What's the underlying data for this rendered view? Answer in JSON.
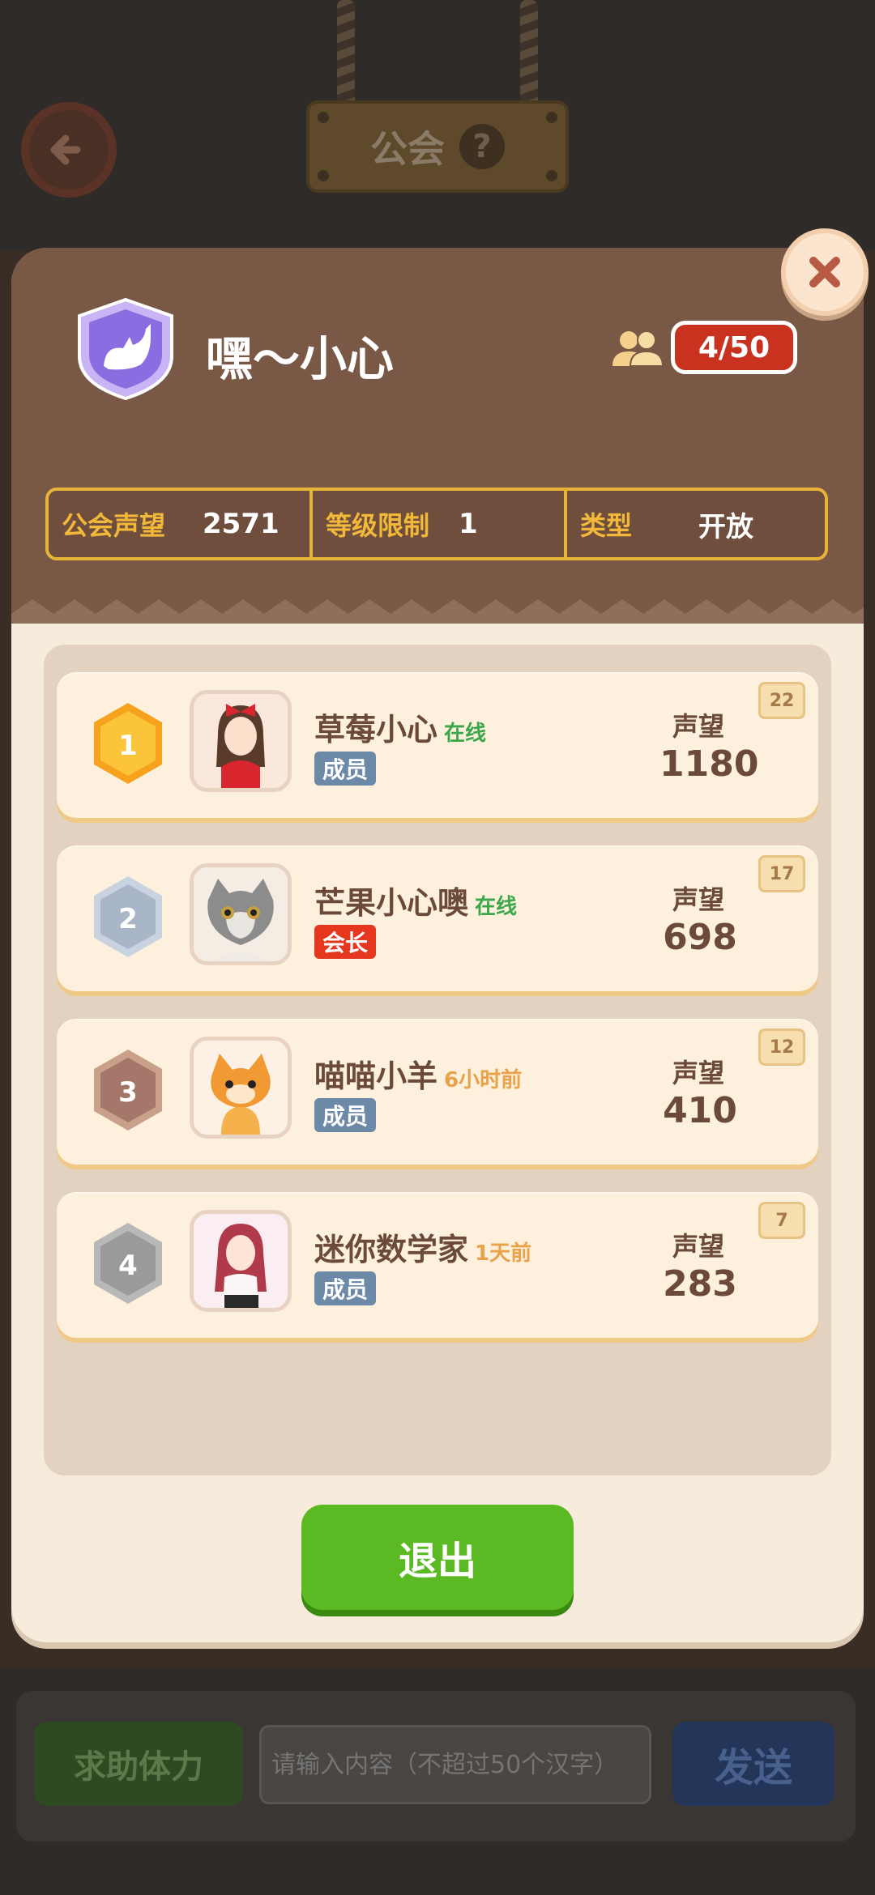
{
  "background_page": {
    "title": "公会",
    "help_icon": "?",
    "back_icon": "back-arrow-icon",
    "chat": {
      "help_button": "求助体力",
      "input_placeholder": "请输入内容（不超过50个汉字）",
      "send_button": "发送"
    }
  },
  "guild": {
    "name": "嘿～小心",
    "emblem_icon": "cat-shield-icon",
    "member_count": "4/50",
    "stats": [
      {
        "label": "公会声望",
        "value": "2571"
      },
      {
        "label": "等级限制",
        "value": "1"
      },
      {
        "label": "类型",
        "value": "开放"
      }
    ]
  },
  "members": [
    {
      "rank": "1",
      "name": "草莓小心",
      "status": "在线",
      "status_color": "#3aa84a",
      "role": "成员",
      "role_color": "#6c8aa8",
      "reputation_label": "声望",
      "reputation": "1180",
      "level": "22"
    },
    {
      "rank": "2",
      "name": "芒果小心噢",
      "status": "在线",
      "status_color": "#3aa84a",
      "role": "会长",
      "role_color": "#e5361e",
      "reputation_label": "声望",
      "reputation": "698",
      "level": "17"
    },
    {
      "rank": "3",
      "name": "喵喵小羊",
      "status": "6小时前",
      "status_color": "#e9a24a",
      "role": "成员",
      "role_color": "#6c8aa8",
      "reputation_label": "声望",
      "reputation": "410",
      "level": "12"
    },
    {
      "rank": "4",
      "name": "迷你数学家",
      "status": "1天前",
      "status_color": "#e9a24a",
      "role": "成员",
      "role_color": "#6c8aa8",
      "reputation_label": "声望",
      "reputation": "283",
      "level": "7"
    }
  ],
  "exit_button": "退出",
  "colors": {
    "header": "#7a5846",
    "gold": "#f1b83a",
    "exit_green": "#5bba23"
  }
}
